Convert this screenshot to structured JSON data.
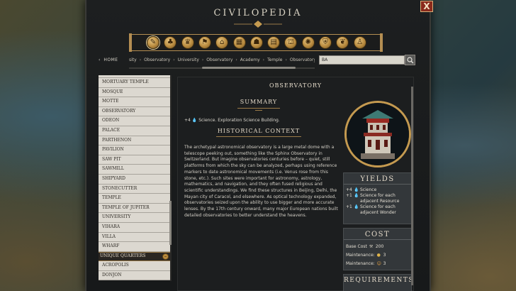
{
  "window": {
    "title": "CIVILOPEDIA",
    "close_label": "X"
  },
  "category_icons": [
    "scroll-icon",
    "tree-icon",
    "cup-icon",
    "flag-icon",
    "building-icon",
    "ruins-icon",
    "helmet-icon",
    "book-icon",
    "landmark-icon",
    "bug-icon",
    "shield-icon",
    "paw-icon",
    "figure-icon"
  ],
  "nav": {
    "home_label": "HOME",
    "breadcrumbs": [
      "sity",
      "Observatory",
      "University",
      "Observatory",
      "Academy",
      "Temple",
      "Observatory"
    ],
    "search_value": "BA"
  },
  "list": {
    "items": [
      "MORTUARY TEMPLE",
      "MOSQUE",
      "MOTTE",
      "OBSERVATORY",
      "ODEON",
      "PALACE",
      "PARTHENON",
      "PAVILION",
      "SAW PIT",
      "SAWMILL",
      "SHIPYARD",
      "STONECUTTER",
      "TEMPLE",
      "TEMPLE OF JUPITER",
      "UNIVERSITY",
      "VIHARA",
      "VILLA",
      "WHARF"
    ],
    "group_label": "UNIQUE QUARTERS",
    "group_toggle": "–",
    "after_group": [
      "ACROPOLIS",
      "DONJON"
    ]
  },
  "article": {
    "title": "OBSERVATORY",
    "summary_heading": "SUMMARY",
    "summary_amount": "+4",
    "summary_text": "Science. Exploration Science Building.",
    "history_heading": "HISTORICAL CONTEXT",
    "history_text": "The archetypal astronomical observatory is a large metal dome with a telescope peeking out, something like the Sphinx Observatory in Switzerland. But imagine observatories centuries before – quiet, still platforms from which the sky can be analyzed, perhaps using reference markers to date astronomical movements (i.e. Venus rose from this stone, etc.). Such sites were important for astronomy, astrology, mathematics, and navigation, and they often fused religious and scientific understandings. We find these structures in Beijing, Delhi, the Mayan city of Caracol, and elsewhere. As optical technology expanded, observatories seized upon the ability to use bigger and more accurate lenses. By the 17th century onward, many major European nations built detailed observatories to better understand the heavens."
  },
  "yields": {
    "heading": "YIELDS",
    "rows": [
      {
        "amount": "+4",
        "text": "Science"
      },
      {
        "amount": "+1",
        "text": "Science for each adjacent Resource"
      },
      {
        "amount": "+1",
        "text": "Science for each adjacent Wonder"
      }
    ]
  },
  "cost": {
    "heading": "COST",
    "base_label": "Base Cost",
    "base_value": "200",
    "maint1_label": "Maintenance:",
    "maint1_value": "3",
    "maint2_label": "Maintenance:",
    "maint2_value": "3"
  },
  "requirements": {
    "heading": "REQUIREMENTS"
  },
  "colors": {
    "accent_gold": "#b48e52",
    "science_blue": "#5c9ee0",
    "list_bg": "#dcd8d0"
  }
}
